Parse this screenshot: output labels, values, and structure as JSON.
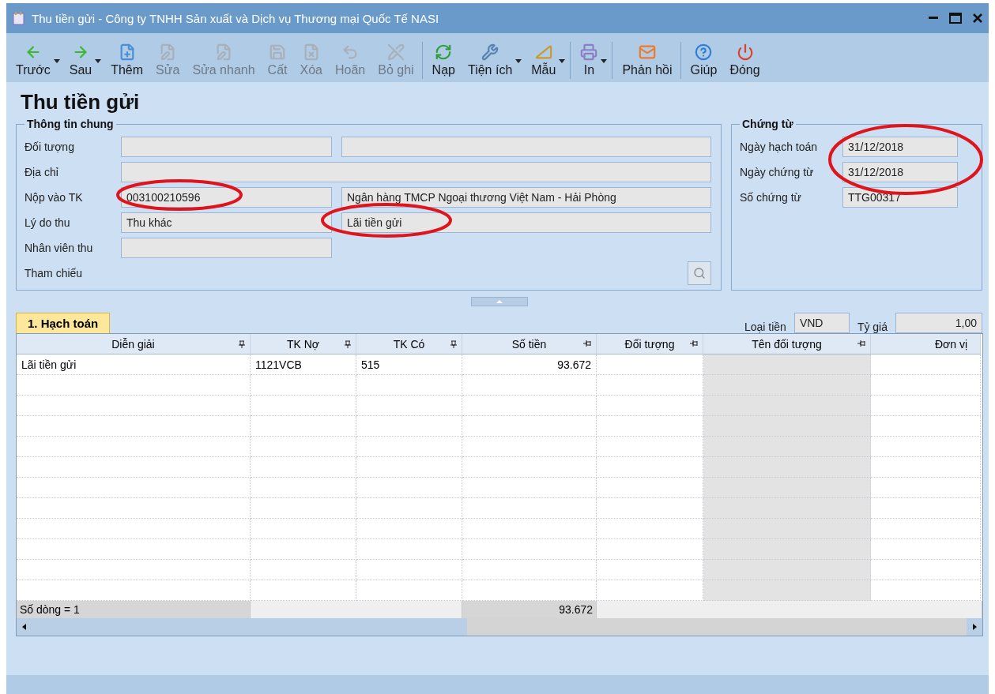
{
  "window": {
    "title": "Thu tiền gửi - Công ty TNHH Sản xuất và Dịch vụ Thương mại Quốc Tế NASI"
  },
  "toolbar": [
    {
      "label": "Trước",
      "disabled": false,
      "dropdown": true,
      "separator_before": false
    },
    {
      "label": "Sau",
      "disabled": false,
      "dropdown": true,
      "separator_before": false
    },
    {
      "label": "Thêm",
      "disabled": false,
      "dropdown": false,
      "separator_before": false
    },
    {
      "label": "Sửa",
      "disabled": true,
      "dropdown": false,
      "separator_before": false
    },
    {
      "label": "Sửa nhanh",
      "disabled": true,
      "dropdown": false,
      "separator_before": false
    },
    {
      "label": "Cất",
      "disabled": true,
      "dropdown": false,
      "separator_before": false
    },
    {
      "label": "Xóa",
      "disabled": true,
      "dropdown": false,
      "separator_before": false
    },
    {
      "label": "Hoãn",
      "disabled": true,
      "dropdown": false,
      "separator_before": false
    },
    {
      "label": "Bỏ ghi",
      "disabled": true,
      "dropdown": false,
      "separator_before": false
    },
    {
      "label": "Nạp",
      "disabled": false,
      "dropdown": false,
      "separator_before": true
    },
    {
      "label": "Tiện ích",
      "disabled": false,
      "dropdown": true,
      "separator_before": false
    },
    {
      "label": "Mẫu",
      "disabled": false,
      "dropdown": true,
      "separator_before": false
    },
    {
      "label": "In",
      "disabled": false,
      "dropdown": true,
      "separator_before": true
    },
    {
      "label": "Phản hồi",
      "disabled": false,
      "dropdown": false,
      "separator_before": true
    },
    {
      "label": "Giúp",
      "disabled": false,
      "dropdown": false,
      "separator_before": true
    },
    {
      "label": "Đóng",
      "disabled": false,
      "dropdown": false,
      "separator_before": false
    }
  ],
  "heading": "Thu tiền gửi",
  "general": {
    "title": "Thông tin chung",
    "rows": [
      {
        "label": "Đối tượng",
        "kind": "pair",
        "fields": [
          {
            "circled": false
          },
          {
            "circled": false
          }
        ]
      },
      {
        "label": "Địa chỉ",
        "kind": "wide",
        "fields": [
          {
            "circled": false
          }
        ]
      },
      {
        "label": "Nộp vào TK",
        "kind": "pair",
        "fields": [
          {
            "value": "003100210596",
            "circled": true
          },
          {
            "value": "Ngân hàng TMCP Ngoại thương Việt Nam - Hải Phòng",
            "circled": false
          }
        ]
      },
      {
        "label": "Lý do thu",
        "kind": "pair",
        "fields": [
          {
            "value": "Thu khác",
            "circled": false
          },
          {
            "value": "Lãi tiền gửi",
            "circled": true
          }
        ]
      },
      {
        "label": "Nhân viên thu",
        "kind": "single",
        "fields": [
          {
            "circled": false
          }
        ]
      },
      {
        "label": "Tham chiếu",
        "kind": "lookup",
        "fields": []
      }
    ]
  },
  "voucher": {
    "title": "Chứng từ",
    "rows": [
      {
        "label": "Ngày hạch toán",
        "value": "31/12/2018",
        "circled": true
      },
      {
        "label": "Ngày chứng từ",
        "value": "31/12/2018",
        "circled": true
      },
      {
        "label": "Số chứng từ",
        "value": "TTG00317",
        "circled": false
      }
    ]
  },
  "tabs": [
    {
      "label": "1. Hạch toán",
      "selected": true
    }
  ],
  "currency": {
    "label": "Loại tiền",
    "value": "VND"
  },
  "rate": {
    "label": "Tỷ giá",
    "value": "1,00"
  },
  "table": {
    "columns": [
      {
        "label": "Diễn giải",
        "readonly": false
      },
      {
        "label": "TK Nợ",
        "readonly": false
      },
      {
        "label": "TK Có",
        "readonly": false
      },
      {
        "label": "Số tiền",
        "readonly": false
      },
      {
        "label": "Đối tượng",
        "readonly": false
      },
      {
        "label": "Tên đối tượng",
        "readonly": true
      },
      {
        "label": "Đơn vị",
        "readonly": false
      }
    ],
    "rows": [
      [
        "Lãi tiền gửi",
        "1121VCB",
        "515",
        "93.672",
        null,
        null,
        null
      ]
    ],
    "footer": {
      "count": "Số dòng = 1",
      "total": "93.672"
    }
  }
}
